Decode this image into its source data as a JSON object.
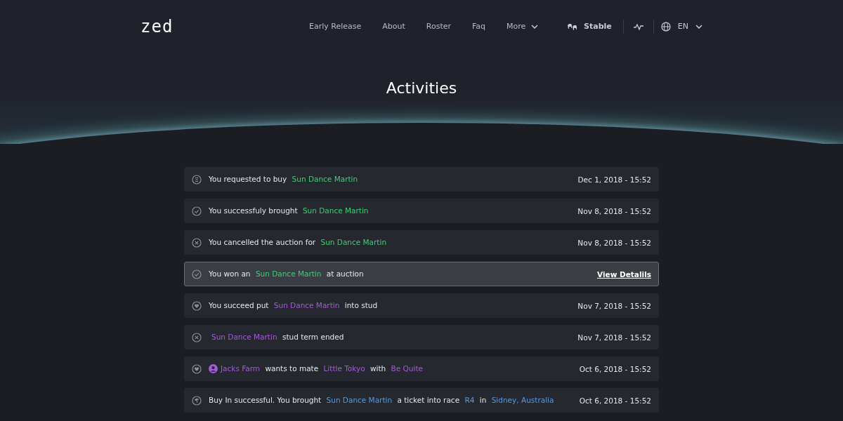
{
  "header": {
    "logo": "zed",
    "nav": [
      {
        "label": "Early Release",
        "dropdown": false
      },
      {
        "label": "About",
        "dropdown": false
      },
      {
        "label": "Roster",
        "dropdown": false
      },
      {
        "label": "Faq",
        "dropdown": false
      },
      {
        "label": "More",
        "dropdown": true
      }
    ],
    "stable": "Stable",
    "language": "EN"
  },
  "title": "Activities",
  "activities": [
    {
      "kind": "coin",
      "selected": false,
      "date": "Dec 1, 2018 - 15:52",
      "parts": [
        {
          "kind": "text",
          "text": "You requested to buy"
        },
        {
          "kind": "link",
          "text": "Sun Dance Martin",
          "color": "#3fcf75"
        }
      ]
    },
    {
      "kind": "check",
      "selected": false,
      "date": "Nov 8, 2018 - 15:52",
      "parts": [
        {
          "kind": "text",
          "text": "You successfuly brought"
        },
        {
          "kind": "link",
          "text": "Sun Dance Martin",
          "color": "#3fcf75"
        }
      ]
    },
    {
      "kind": "cross",
      "selected": false,
      "date": "Nov 8, 2018 - 15:52",
      "parts": [
        {
          "kind": "text",
          "text": "You cancelled the auction for"
        },
        {
          "kind": "link",
          "text": "Sun Dance Martin",
          "color": "#3fcf75"
        }
      ]
    },
    {
      "kind": "check",
      "selected": true,
      "action": "View Detalils",
      "parts": [
        {
          "kind": "text",
          "text": "You won an"
        },
        {
          "kind": "link",
          "text": "Sun Dance Martin",
          "color": "#3fcf75"
        },
        {
          "kind": "text",
          "text": "at auction"
        }
      ]
    },
    {
      "kind": "heart",
      "selected": false,
      "date": "Nov 7, 2018 - 15:52",
      "parts": [
        {
          "kind": "text",
          "text": "You succeed put"
        },
        {
          "kind": "link",
          "text": "Sun Dance Martin",
          "color": "#a45bd6"
        },
        {
          "kind": "text",
          "text": "into stud"
        }
      ]
    },
    {
      "kind": "cross",
      "selected": false,
      "date": "Nov 7, 2018 - 15:52",
      "parts": [
        {
          "kind": "link",
          "text": "Sun Dance Martin",
          "color": "#a45bd6"
        },
        {
          "kind": "text",
          "text": "stud term ended"
        }
      ]
    },
    {
      "kind": "heart",
      "selected": false,
      "date": "Oct 6, 2018 - 15:52",
      "parts": [
        {
          "kind": "user",
          "text": "Jacks Farm",
          "color": "#a45bd6"
        },
        {
          "kind": "text",
          "text": "wants to mate"
        },
        {
          "kind": "link",
          "text": "Little Tokyo",
          "color": "#a45bd6"
        },
        {
          "kind": "text",
          "text": "with"
        },
        {
          "kind": "link",
          "text": "Be Quite",
          "color": "#a45bd6"
        }
      ]
    },
    {
      "kind": "horse",
      "selected": false,
      "date": "Oct 6, 2018 - 15:52",
      "parts": [
        {
          "kind": "text",
          "text": "Buy In successful. You brought"
        },
        {
          "kind": "link",
          "text": "Sun Dance Martin",
          "color": "#5b9be0"
        },
        {
          "kind": "text",
          "text": "a ticket into race"
        },
        {
          "kind": "link",
          "text": "R4",
          "color": "#5b9be0"
        },
        {
          "kind": "text",
          "text": "in"
        },
        {
          "kind": "link",
          "text": "Sidney, Australia",
          "color": "#5b9be0"
        }
      ]
    }
  ]
}
